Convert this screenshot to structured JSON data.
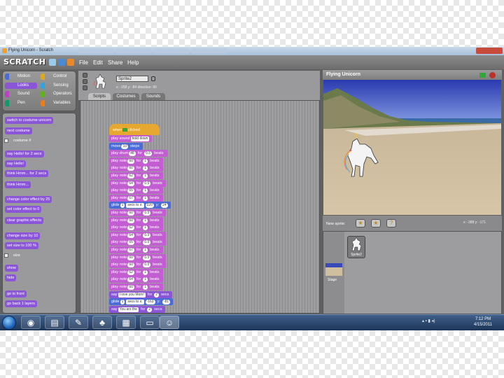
{
  "window": {
    "title": "Flying Unicorn - Scratch"
  },
  "menu": {
    "logo": "SCRATCH",
    "items": [
      "File",
      "Edit",
      "Share",
      "Help"
    ]
  },
  "categories": [
    {
      "label": "Motion",
      "color": "#4a6cd4"
    },
    {
      "label": "Control",
      "color": "#e1a91a"
    },
    {
      "label": "Looks",
      "color": "#8a55d7"
    },
    {
      "label": "Sensing",
      "color": "#2ca5e2"
    },
    {
      "label": "Sound",
      "color": "#bb42c3"
    },
    {
      "label": "Operators",
      "color": "#5cb712"
    },
    {
      "label": "Pen",
      "color": "#0e9a6c"
    },
    {
      "label": "Variables",
      "color": "#ee7d16"
    }
  ],
  "palette": [
    "switch to costume unicorn",
    "next costume",
    "costume #",
    "say Hello! for 2 secs",
    "say Hello!",
    "think Hmm... for 2 secs",
    "think Hmm...",
    "change color effect by 25",
    "set color effect to 0",
    "clear graphic effects",
    "change size by 10",
    "set size to 100 %",
    "size",
    "show",
    "hide",
    "go to front",
    "go back 1 layers"
  ],
  "sprite": {
    "name": "Sprite2",
    "coords": "x: -158  y: -84   direction: 90"
  },
  "tabs": [
    "Scripts",
    "Costumes",
    "Sounds"
  ],
  "script": {
    "hat": "when clicked",
    "blocks": [
      {
        "kind": "sound",
        "text": "play sound",
        "args": [
          "hold down"
        ]
      },
      {
        "kind": "motion",
        "text": "move",
        "args": [
          "10",
          "steps"
        ]
      },
      {
        "kind": "sound",
        "text": "play drum",
        "args": [
          "48",
          "for",
          "0.5",
          "beats"
        ]
      },
      {
        "kind": "sound",
        "text": "play note",
        "args": [
          "60",
          "for",
          "1",
          "beats"
        ]
      },
      {
        "kind": "sound",
        "text": "play note",
        "args": [
          "60",
          "for",
          "1",
          "beats"
        ]
      },
      {
        "kind": "sound",
        "text": "play note",
        "args": [
          "62",
          "for",
          "1",
          "beats"
        ]
      },
      {
        "kind": "sound",
        "text": "play note",
        "args": [
          "64",
          "for",
          "0.5",
          "beats"
        ]
      },
      {
        "kind": "sound",
        "text": "play note",
        "args": [
          "65",
          "for",
          "1",
          "beats"
        ]
      },
      {
        "kind": "sound",
        "text": "play note",
        "args": [
          "67",
          "for",
          "1",
          "beats"
        ]
      },
      {
        "kind": "motion",
        "text": "glide",
        "args": [
          "1",
          "secs to x:",
          "220",
          "y:",
          "24"
        ]
      },
      {
        "kind": "sound",
        "text": "play note",
        "args": [
          "60",
          "for",
          "0.5",
          "beats"
        ]
      },
      {
        "kind": "sound",
        "text": "play note",
        "args": [
          "60",
          "for",
          "1",
          "beats"
        ]
      },
      {
        "kind": "sound",
        "text": "play note",
        "args": [
          "62",
          "for",
          "1",
          "beats"
        ]
      },
      {
        "kind": "sound",
        "text": "play note",
        "args": [
          "64",
          "for",
          "0.5",
          "beats"
        ]
      },
      {
        "kind": "sound",
        "text": "play note",
        "args": [
          "65",
          "for",
          "0.5",
          "beats"
        ]
      },
      {
        "kind": "sound",
        "text": "play note",
        "args": [
          "67",
          "for",
          "1",
          "beats"
        ]
      },
      {
        "kind": "sound",
        "text": "play note",
        "args": [
          "60",
          "for",
          "0.5",
          "beats"
        ]
      },
      {
        "kind": "sound",
        "text": "play note",
        "args": [
          "60",
          "for",
          "0.5",
          "beats"
        ]
      },
      {
        "kind": "sound",
        "text": "play note",
        "args": [
          "62",
          "for",
          "1",
          "beats"
        ]
      },
      {
        "kind": "sound",
        "text": "play note",
        "args": [
          "64",
          "for",
          "1",
          "beats"
        ]
      },
      {
        "kind": "sound",
        "text": "play note",
        "args": [
          "60",
          "for",
          "1",
          "beats"
        ]
      },
      {
        "kind": "looks",
        "text": "say",
        "args": [
          "I love you Mom!",
          "for",
          "2",
          "secs"
        ]
      },
      {
        "kind": "motion",
        "text": "glide",
        "args": [
          "1",
          "secs to x:",
          "-163",
          "y:",
          "-81"
        ]
      },
      {
        "kind": "looks",
        "text": "say",
        "args": [
          "You are the",
          "for",
          "2",
          "secs"
        ]
      }
    ]
  },
  "stage": {
    "title": "Flying Unicorn",
    "new_sprite_label": "New sprite:",
    "pos": "x: -388   y: -171",
    "stage_label": "Stage"
  },
  "sprites_list": [
    {
      "label": "Sprite2"
    }
  ],
  "taskbar": {
    "time": "7:12 PM",
    "date": "4/15/2011"
  },
  "colors": {
    "sound": "#c25dd2",
    "motion": "#4a6bd8",
    "looks": "#8a55d7",
    "control": "#e6a830"
  }
}
